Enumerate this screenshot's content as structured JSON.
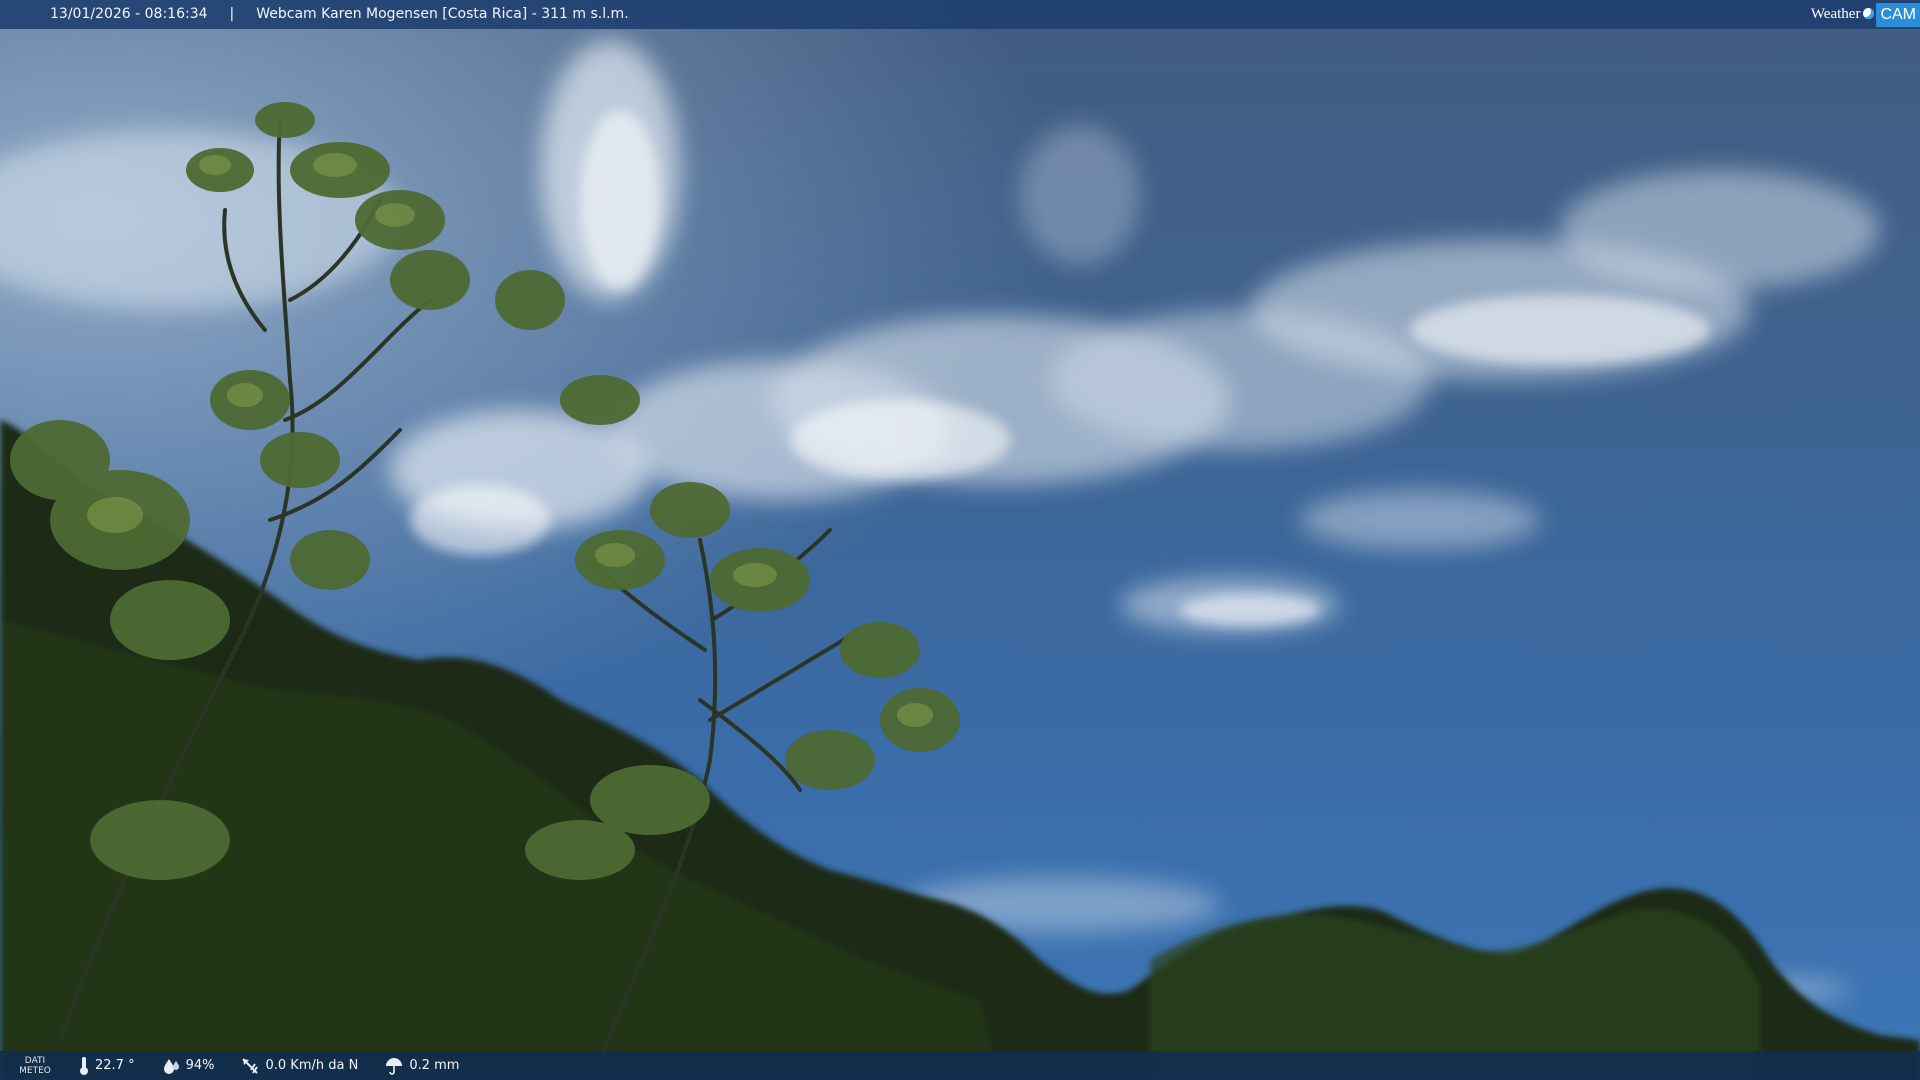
{
  "header": {
    "datetime": "13/01/2026 - 08:16:34",
    "separator": "|",
    "title": "Webcam Karen Mogensen [Costa Rica] - 311 m s.l.m."
  },
  "logo": {
    "weather_text": "Weather",
    "cam_text": "CAM"
  },
  "footer": {
    "label_line1": "DATI",
    "label_line2": "METEO",
    "temperature": "22.7 °",
    "humidity": "94%",
    "wind": "0.0 Km/h da N",
    "rain": "0.2 mm"
  },
  "icons": {
    "temperature": "thermometer-icon",
    "humidity": "humidity-drops-icon",
    "wind": "wind-vane-icon",
    "rain": "rain-umbrella-icon"
  }
}
